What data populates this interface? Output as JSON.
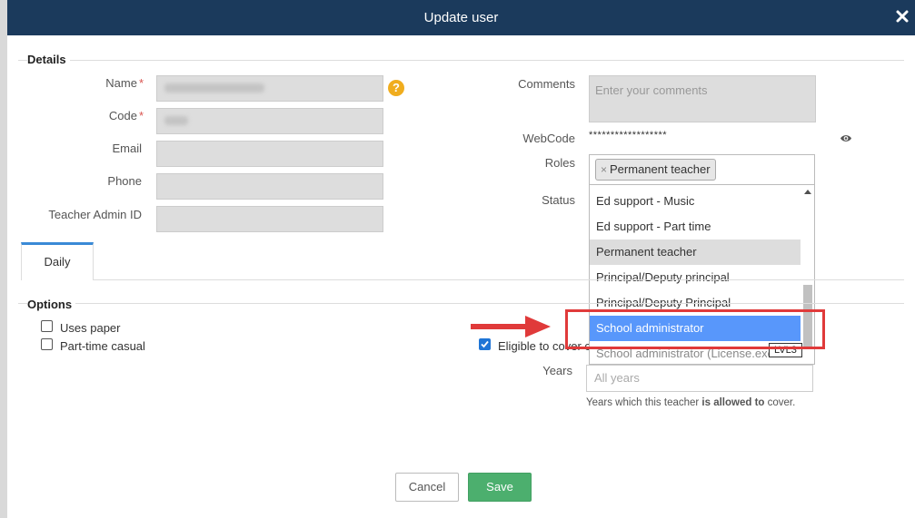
{
  "dialog": {
    "title": "Update user"
  },
  "details": {
    "section_label": "Details",
    "fields": {
      "name_label": "Name",
      "code_label": "Code",
      "email_label": "Email",
      "phone_label": "Phone",
      "teacher_admin_id_label": "Teacher Admin ID",
      "required_marker": "*",
      "help_icon_glyph": "?"
    },
    "comments_label": "Comments",
    "comments_placeholder": "Enter your comments",
    "webcode_label": "WebCode",
    "webcode_value": "******************",
    "roles_label": "Roles",
    "status_label": "Status",
    "selected_role_chip": "Permanent teacher",
    "chip_remove": "×"
  },
  "roles_dropdown": {
    "options": [
      {
        "label": "Ed support - Music",
        "state": "normal"
      },
      {
        "label": "Ed support - Part time",
        "state": "normal"
      },
      {
        "label": "Permanent teacher",
        "state": "selected"
      },
      {
        "label": "Principal/Deputy principal",
        "state": "normal"
      },
      {
        "label": "Principal/Deputy Principal",
        "state": "normal"
      },
      {
        "label": "School administrator",
        "state": "hover"
      },
      {
        "label": "School administrator (License.exe",
        "state": "faded"
      }
    ],
    "tooltip": "LVL3"
  },
  "tabs": [
    {
      "label": "Daily",
      "active": true
    }
  ],
  "options": {
    "section_label": "Options",
    "uses_paper": {
      "label": "Uses paper",
      "checked": false
    },
    "part_time_casual": {
      "label": "Part-time casual",
      "checked": false
    },
    "eligible_to_cover": {
      "label": "Eligible to cover c",
      "checked": true
    },
    "years_label": "Years",
    "years_placeholder": "All years",
    "years_hint_pre": "Years which this teacher ",
    "years_hint_bold": "is allowed to",
    "years_hint_post": " cover."
  },
  "buttons": {
    "cancel": "Cancel",
    "save": "Save"
  },
  "icons": {
    "close": "close-icon",
    "eye": "eye-icon",
    "help": "help-icon",
    "arrow": "arrow-right-icon"
  },
  "colors": {
    "titlebar": "#1b3a5c",
    "save_button": "#4caf6e",
    "highlight": "#e03a3a",
    "hover_option": "#5897fb",
    "help_icon": "#f0ad1e",
    "tab_accent": "#3a8ad6"
  }
}
